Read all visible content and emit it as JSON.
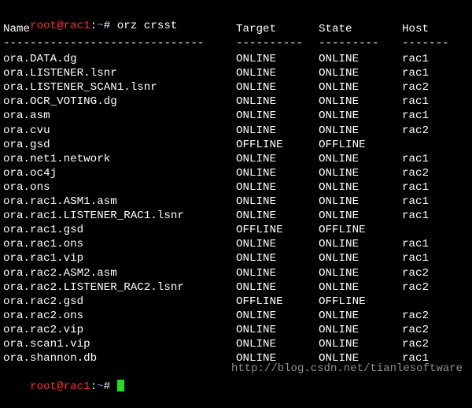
{
  "prompt1": {
    "user": "root@rac1",
    "path": "~",
    "symbol": "# ",
    "command": "orz crsst"
  },
  "header": {
    "name": "Name",
    "target": "Target",
    "state": "State",
    "host": "Host"
  },
  "separator": {
    "name": "------------------------------",
    "target": "----------",
    "state": "---------",
    "host": "-------"
  },
  "rows": [
    {
      "name": "ora.DATA.dg",
      "target": "ONLINE",
      "state": "ONLINE",
      "host": "rac1"
    },
    {
      "name": "ora.LISTENER.lsnr",
      "target": "ONLINE",
      "state": "ONLINE",
      "host": "rac1"
    },
    {
      "name": "ora.LISTENER_SCAN1.lsnr",
      "target": "ONLINE",
      "state": "ONLINE",
      "host": "rac2"
    },
    {
      "name": "ora.OCR_VOTING.dg",
      "target": "ONLINE",
      "state": "ONLINE",
      "host": "rac1"
    },
    {
      "name": "ora.asm",
      "target": "ONLINE",
      "state": "ONLINE",
      "host": "rac1"
    },
    {
      "name": "ora.cvu",
      "target": "ONLINE",
      "state": "ONLINE",
      "host": "rac2"
    },
    {
      "name": "ora.gsd",
      "target": "OFFLINE",
      "state": "OFFLINE",
      "host": ""
    },
    {
      "name": "ora.net1.network",
      "target": "ONLINE",
      "state": "ONLINE",
      "host": "rac1"
    },
    {
      "name": "ora.oc4j",
      "target": "ONLINE",
      "state": "ONLINE",
      "host": "rac2"
    },
    {
      "name": "ora.ons",
      "target": "ONLINE",
      "state": "ONLINE",
      "host": "rac1"
    },
    {
      "name": "ora.rac1.ASM1.asm",
      "target": "ONLINE",
      "state": "ONLINE",
      "host": "rac1"
    },
    {
      "name": "ora.rac1.LISTENER_RAC1.lsnr",
      "target": "ONLINE",
      "state": "ONLINE",
      "host": "rac1"
    },
    {
      "name": "ora.rac1.gsd",
      "target": "OFFLINE",
      "state": "OFFLINE",
      "host": ""
    },
    {
      "name": "ora.rac1.ons",
      "target": "ONLINE",
      "state": "ONLINE",
      "host": "rac1"
    },
    {
      "name": "ora.rac1.vip",
      "target": "ONLINE",
      "state": "ONLINE",
      "host": "rac1"
    },
    {
      "name": "ora.rac2.ASM2.asm",
      "target": "ONLINE",
      "state": "ONLINE",
      "host": "rac2"
    },
    {
      "name": "ora.rac2.LISTENER_RAC2.lsnr",
      "target": "ONLINE",
      "state": "ONLINE",
      "host": "rac2"
    },
    {
      "name": "ora.rac2.gsd",
      "target": "OFFLINE",
      "state": "OFFLINE",
      "host": ""
    },
    {
      "name": "ora.rac2.ons",
      "target": "ONLINE",
      "state": "ONLINE",
      "host": "rac2"
    },
    {
      "name": "ora.rac2.vip",
      "target": "ONLINE",
      "state": "ONLINE",
      "host": "rac2"
    },
    {
      "name": "ora.scan1.vip",
      "target": "ONLINE",
      "state": "ONLINE",
      "host": "rac2"
    },
    {
      "name": "ora.shannon.db",
      "target": "ONLINE",
      "state": "ONLINE",
      "host": "rac1"
    }
  ],
  "prompt2": {
    "user": "root@rac1",
    "path": "~",
    "symbol": "# "
  },
  "watermark": "http://blog.csdn.net/tianlesoftware",
  "colors": {
    "background": "#000000",
    "text": "#ffffff",
    "user": "#ff3030",
    "path": "#6f8cff",
    "cursor": "#22dd22"
  }
}
